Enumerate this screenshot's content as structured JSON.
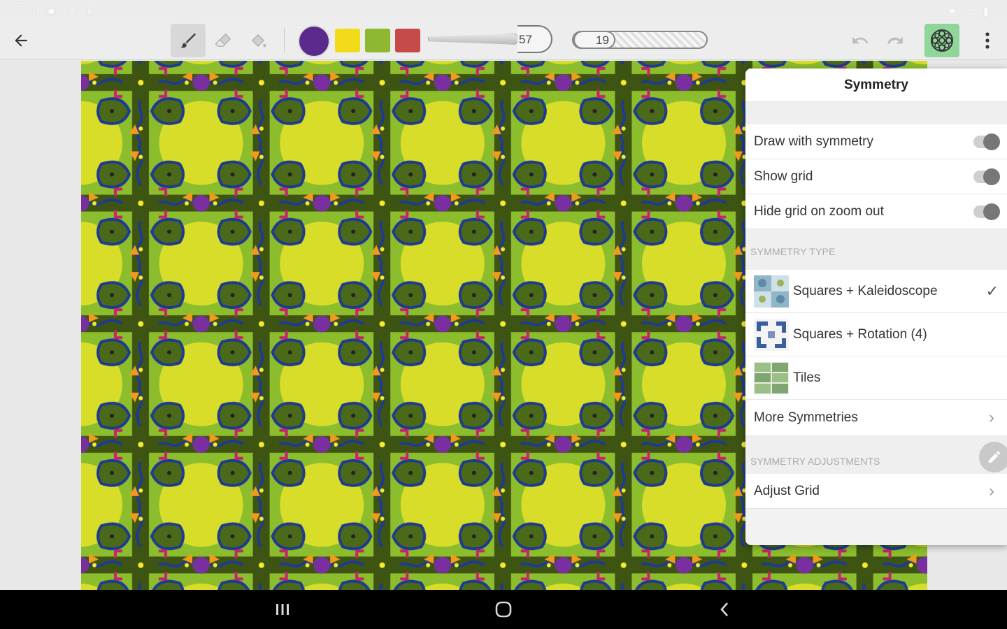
{
  "status_bar": {
    "time": "5:39",
    "left_icons": "▣ ✕ k",
    "right_icons": "✱ ᯤ ▮"
  },
  "toolbar": {
    "back_icon": "arrow-left-icon",
    "tools": [
      "brush",
      "eraser",
      "fill"
    ],
    "active_tool": "brush",
    "colors": [
      "#5a2a8c",
      "#f2dc1a",
      "#8db82f",
      "#c54a4a"
    ],
    "brush_size": "57",
    "opacity": "19"
  },
  "canvas": {
    "palette": {
      "background": "#8cbd2c",
      "dark_green": "#3e5412",
      "navy": "#1f3a8f",
      "yellow": "#f6ea2c",
      "magenta": "#c4246a",
      "orange": "#f39a1e",
      "purple": "#7a2fa0"
    }
  },
  "symmetry_panel": {
    "title": "Symmetry",
    "toggles": [
      {
        "label": "Draw with symmetry",
        "on": false
      },
      {
        "label": "Show grid",
        "on": false
      },
      {
        "label": "Hide grid on zoom out",
        "on": false
      }
    ],
    "type_section_label": "SYMMETRY TYPE",
    "types": [
      {
        "label": "Squares + Kaleidoscope",
        "selected": true
      },
      {
        "label": "Squares + Rotation (4)",
        "selected": false
      },
      {
        "label": "Tiles",
        "selected": false
      }
    ],
    "more_label": "More Symmetries",
    "adjust_section_label": "SYMMETRY ADJUSTMENTS",
    "adjust_label": "Adjust Grid",
    "check_mark": "✓",
    "chevron": "›"
  }
}
